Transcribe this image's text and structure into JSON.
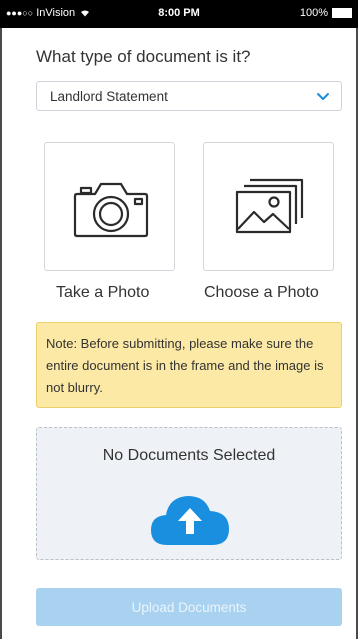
{
  "status_bar": {
    "carrier": "InVision",
    "time": "8:00 PM",
    "battery": "100%"
  },
  "form": {
    "question": "What type of document is it?",
    "document_type": {
      "selected": "Landlord Statement"
    }
  },
  "options": {
    "take_photo": "Take a Photo",
    "choose_photo": "Choose a Photo"
  },
  "note": "Note: Before submitting, please make sure the entire document is in the frame and the image is not blurry.",
  "dropzone": {
    "empty_text": "No Documents Selected"
  },
  "upload_button": "Upload Documents",
  "colors": {
    "accent": "#1a8fe0",
    "note_bg": "#fce9a5",
    "button_disabled": "#a9d1f0"
  }
}
